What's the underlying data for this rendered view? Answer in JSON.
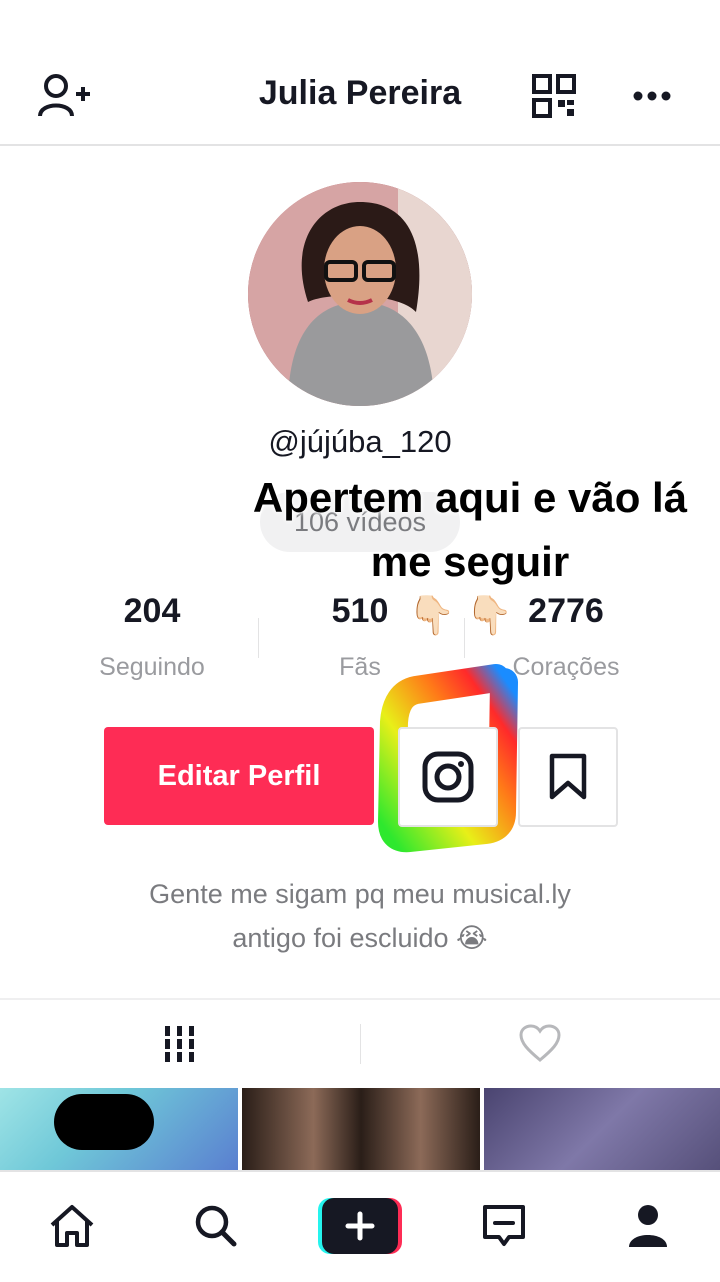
{
  "header": {
    "title": "Julia Pereira"
  },
  "profile": {
    "handle": "@jújúba_120",
    "videos_label": "106 vídeos",
    "overlay_text": "Apertem aqui e vão lá me seguir",
    "stats": [
      {
        "value": "204",
        "label": "Seguindo"
      },
      {
        "value": "510",
        "label": "Fãs"
      },
      {
        "value": "2776",
        "label": "Corações"
      }
    ],
    "pointing_emoji": "👇🏻 👇🏻",
    "edit_button": "Editar Perfil",
    "bio_line1": "Gente me sigam pq meu musical.ly",
    "bio_line2": "antigo foi escluido 😭"
  },
  "colors": {
    "accent": "#fe2c55",
    "text": "#161823",
    "muted": "#7a7b7f"
  },
  "icons": {
    "add_user": "add-user-icon",
    "qr": "qr-code-icon",
    "more": "more-icon",
    "instagram": "instagram-icon",
    "bookmark": "bookmark-icon",
    "grid": "grid-icon",
    "heart": "heart-icon",
    "home": "home-icon",
    "search": "search-icon",
    "create": "plus-icon",
    "inbox": "inbox-icon",
    "profile": "profile-icon"
  }
}
